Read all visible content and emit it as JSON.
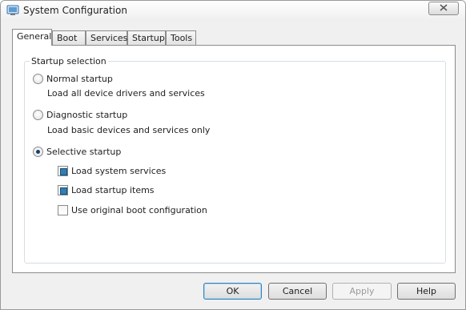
{
  "window": {
    "title": "System Configuration"
  },
  "tabs": [
    {
      "label": "General",
      "active": true
    },
    {
      "label": "Boot",
      "active": false
    },
    {
      "label": "Services",
      "active": false
    },
    {
      "label": "Startup",
      "active": false
    },
    {
      "label": "Tools",
      "active": false
    }
  ],
  "startup": {
    "group_label": "Startup selection",
    "normal": {
      "label": "Normal startup",
      "desc": "Load all device drivers and services",
      "checked": false
    },
    "diagnostic": {
      "label": "Diagnostic startup",
      "desc": "Load basic devices and services only",
      "checked": false
    },
    "selective": {
      "label": "Selective startup",
      "checked": true
    },
    "options": [
      {
        "label": "Load system services",
        "state": "indeterminate"
      },
      {
        "label": "Load startup items",
        "state": "indeterminate"
      },
      {
        "label": "Use original boot configuration",
        "state": "unchecked"
      }
    ]
  },
  "buttons": {
    "ok": "OK",
    "cancel": "Cancel",
    "apply": "Apply",
    "help": "Help"
  },
  "colors": {
    "check_fill": "#2f7fb6",
    "apply_disabled_text": "#9a9a9a"
  }
}
